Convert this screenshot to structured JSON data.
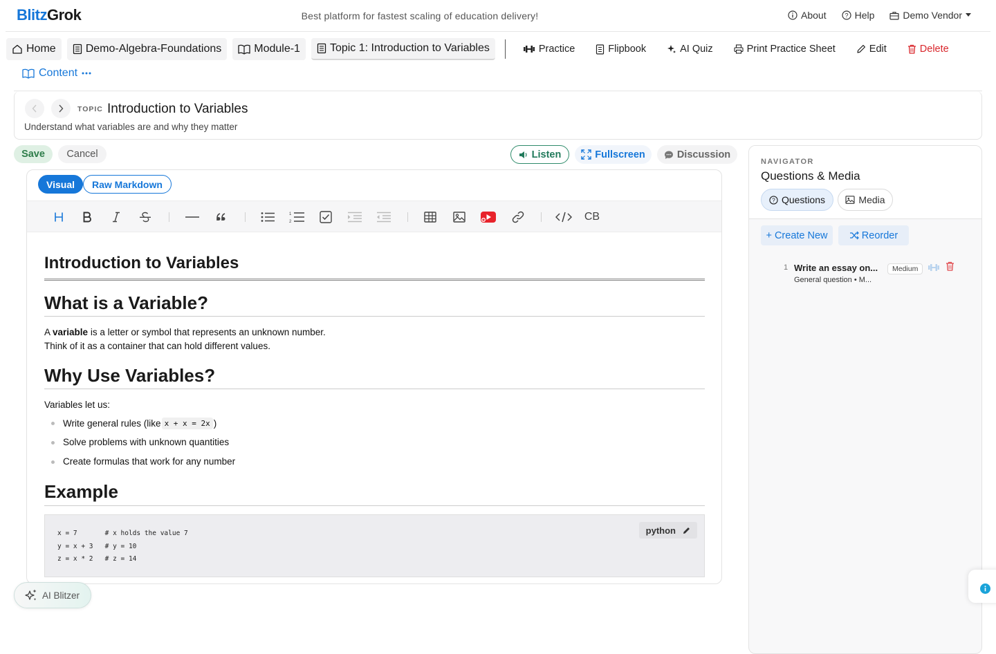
{
  "brand": {
    "part1": "Blitz",
    "part2": "Grok"
  },
  "tagline": "Best platform for fastest scaling of education delivery!",
  "top_links": {
    "about": "About",
    "help": "Help",
    "vendor": "Demo Vendor"
  },
  "breadcrumbs": [
    "Home",
    "Demo-Algebra-Foundations",
    "Module-1",
    "Topic 1: Introduction to Variables"
  ],
  "actions": {
    "practice": "Practice",
    "flipbook": "Flipbook",
    "ai_quiz": "AI Quiz",
    "print": "Print Practice Sheet",
    "edit": "Edit",
    "delete": "Delete"
  },
  "content_link": "Content",
  "topic": {
    "kicker": "TOPIC",
    "title": "Introduction to Variables",
    "subtitle": "Understand what variables are and why they matter"
  },
  "editor_actions": {
    "save": "Save",
    "cancel": "Cancel",
    "listen": "Listen",
    "fullscreen": "Fullscreen",
    "discussion": "Discussion"
  },
  "mode_tabs": {
    "visual": "Visual",
    "raw": "Raw Markdown"
  },
  "toolbar": {
    "codeblock_label": "CB"
  },
  "document": {
    "h1": "Introduction to Variables",
    "h2_what": "What is a Variable?",
    "p1_pre": "A ",
    "p1_bold": "variable",
    "p1_post": " is a letter or symbol that represents an unknown number.",
    "p1_line2": "Think of it as a container that can hold different values.",
    "h2_why": "Why Use Variables?",
    "p2": "Variables let us:",
    "bullets": {
      "b1_pre": "Write general rules (like ",
      "b1_code": "x + x = 2x",
      "b1_post": ")",
      "b2": "Solve problems with unknown quantities",
      "b3": "Create formulas that work for any number"
    },
    "h2_example": "Example",
    "code_lang": "python",
    "code_lines": [
      "x = 7       # x holds the value 7",
      "y = x + 3   # y = 10",
      "z = x * 2   # z = 14"
    ]
  },
  "ai_button": "AI Blitzer",
  "navigator": {
    "kicker": "NAVIGATOR",
    "title": "Questions & Media",
    "tab_questions": "Questions",
    "tab_media": "Media",
    "create_new": "+ Create New",
    "reorder": "Reorder",
    "questions": [
      {
        "num": "1",
        "title": "Write an essay on...",
        "badge": "Medium",
        "sub": "General question • M..."
      }
    ]
  },
  "colors": {
    "accent": "#1677d9",
    "danger": "#d9262b",
    "success": "#2e7d4a",
    "info": "#1aa3d9"
  }
}
